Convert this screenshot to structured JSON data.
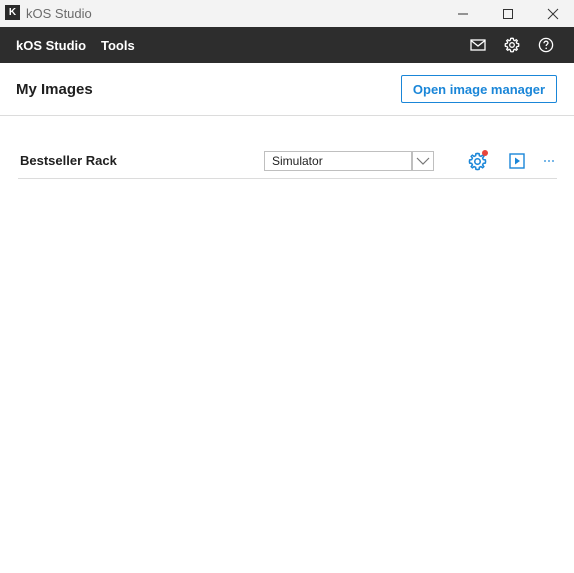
{
  "window": {
    "logo_letter": "K",
    "title": "kOS Studio"
  },
  "menubar": {
    "items": [
      {
        "label": "kOS Studio"
      },
      {
        "label": "Tools"
      }
    ],
    "icons": [
      "mail-icon",
      "gear-icon",
      "help-icon"
    ]
  },
  "header": {
    "title": "My Images",
    "open_manager_label": "Open image manager"
  },
  "images": [
    {
      "name": "Bestseller Rack",
      "target": "Simulator",
      "actions": [
        "settings-icon",
        "run-icon",
        "more-icon"
      ]
    }
  ],
  "colors": {
    "accent": "#1a86d8",
    "menubar": "#2d2d2d",
    "notification": "#e8453c"
  }
}
